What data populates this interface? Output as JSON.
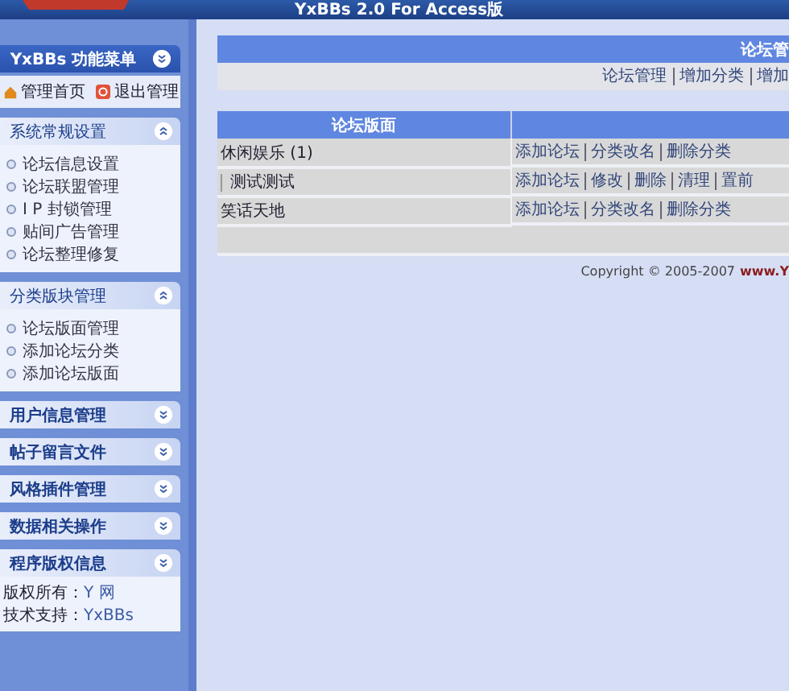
{
  "header": {
    "title": "YxBBs 2.0 For Access版"
  },
  "sidebar": {
    "title": "YxBBs 功能菜单",
    "top_links": [
      {
        "label": "管理首页",
        "kind": "home"
      },
      {
        "label": "退出管理",
        "kind": "exit"
      }
    ],
    "sections": [
      {
        "title": "系统常规设置",
        "expanded": true,
        "items": [
          "论坛信息设置",
          "论坛联盟管理",
          "I P 封锁管理",
          "贴间广告管理",
          "论坛整理修复"
        ]
      },
      {
        "title": "分类版块管理",
        "expanded": true,
        "items": [
          "论坛版面管理",
          "添加论坛分类",
          "添加论坛版面"
        ]
      },
      {
        "title": "用户信息管理",
        "expanded": false
      },
      {
        "title": "帖子留言文件",
        "expanded": false
      },
      {
        "title": "风格插件管理",
        "expanded": false
      },
      {
        "title": "数据相关操作",
        "expanded": false
      },
      {
        "title": "程序版权信息",
        "expanded": false,
        "info": [
          {
            "label": "版权所有：",
            "value": "Y 网"
          },
          {
            "label": "技术支持：",
            "value": "YxBBs"
          }
        ]
      }
    ]
  },
  "main": {
    "panel_title": "论坛管",
    "links": [
      "论坛管理",
      "增加分类",
      "增加"
    ],
    "table": {
      "columns": [
        "论坛版面",
        ""
      ],
      "rows": [
        {
          "name": "休闲娱乐 (1)",
          "child": false,
          "actions": [
            "添加论坛",
            "分类改名",
            "删除分类"
          ]
        },
        {
          "name": "测试测试",
          "child": true,
          "actions": [
            "添加论坛",
            "修改",
            "删除",
            "清理",
            "置前"
          ]
        },
        {
          "name": "笑话天地",
          "child": false,
          "actions": [
            "添加论坛",
            "分类改名",
            "删除分类"
          ]
        }
      ]
    },
    "copyright": "Copyright © 2005-2007",
    "site": "www.Y"
  }
}
